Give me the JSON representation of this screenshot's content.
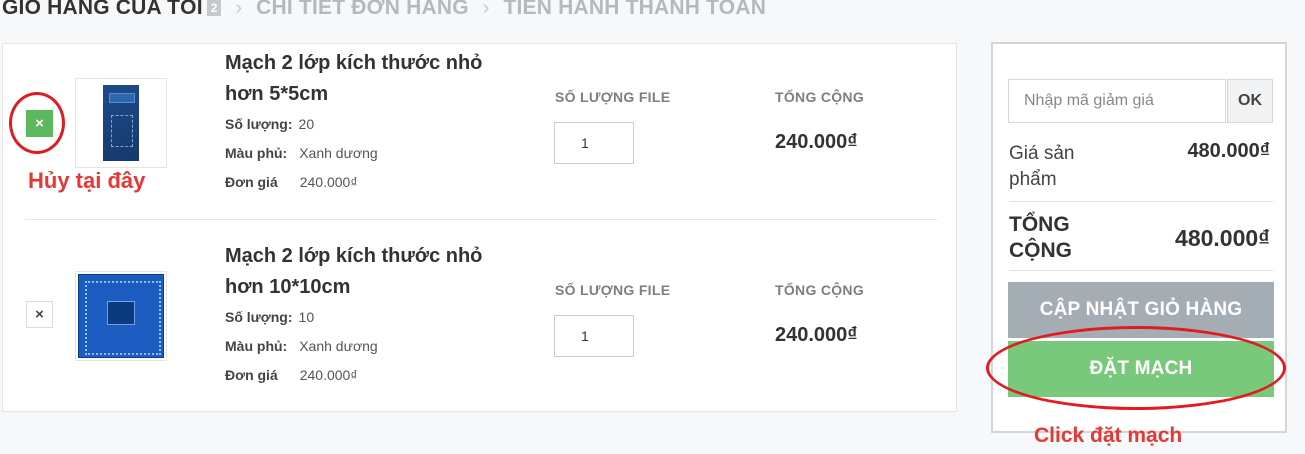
{
  "breadcrumb": {
    "step1": "GIỎ HÀNG CỦA TÔI",
    "step1_count": "2",
    "step2": "CHI TIẾT ĐƠN HÀNG",
    "step3": "TIẾN HÀNH THANH TOÁN",
    "separator": "›"
  },
  "cart": {
    "items": [
      {
        "remove_icon": "×",
        "name": "Mạch 2 lớp kích thước nhỏ hơn 5*5cm",
        "qty_label": "Số lượng:",
        "qty_value": "20",
        "color_label": "Màu phủ:",
        "color_value": "Xanh dương",
        "price_label": "Đơn giá",
        "price_value": "240.000₫",
        "file_qty_header": "SỐ LƯỢNG FILE",
        "file_qty": "1",
        "total_header": "TỔNG CỘNG",
        "total": "240.000₫"
      },
      {
        "remove_icon": "×",
        "name": "Mạch 2 lớp kích thước nhỏ hơn 10*10cm",
        "qty_label": "Số lượng:",
        "qty_value": "10",
        "color_label": "Màu phủ:",
        "color_value": "Xanh dương",
        "price_label": "Đơn giá",
        "price_value": "240.000₫",
        "file_qty_header": "SỐ LƯỢNG FILE",
        "file_qty": "1",
        "total_header": "TỔNG CỘNG",
        "total": "240.000₫"
      }
    ]
  },
  "annotations": {
    "cancel_here": "Hủy tại đây",
    "click_order": "Click đặt mạch",
    "annotation_color": "#e53935"
  },
  "summary": {
    "coupon_placeholder": "Nhập mã giảm giá",
    "ok_label": "OK",
    "subtotal_label": "Giá sản phẩm",
    "subtotal_value": "480.000₫",
    "total_label": "TỔNG CỘNG",
    "total_value": "480.000₫",
    "update_cart": "CẬP NHẬT GIỎ HÀNG",
    "place_order": "ĐẶT MẠCH"
  },
  "colors": {
    "green_button": "#79c97d",
    "grey_button": "#a5adb4",
    "remove_green": "#5cb85c"
  }
}
